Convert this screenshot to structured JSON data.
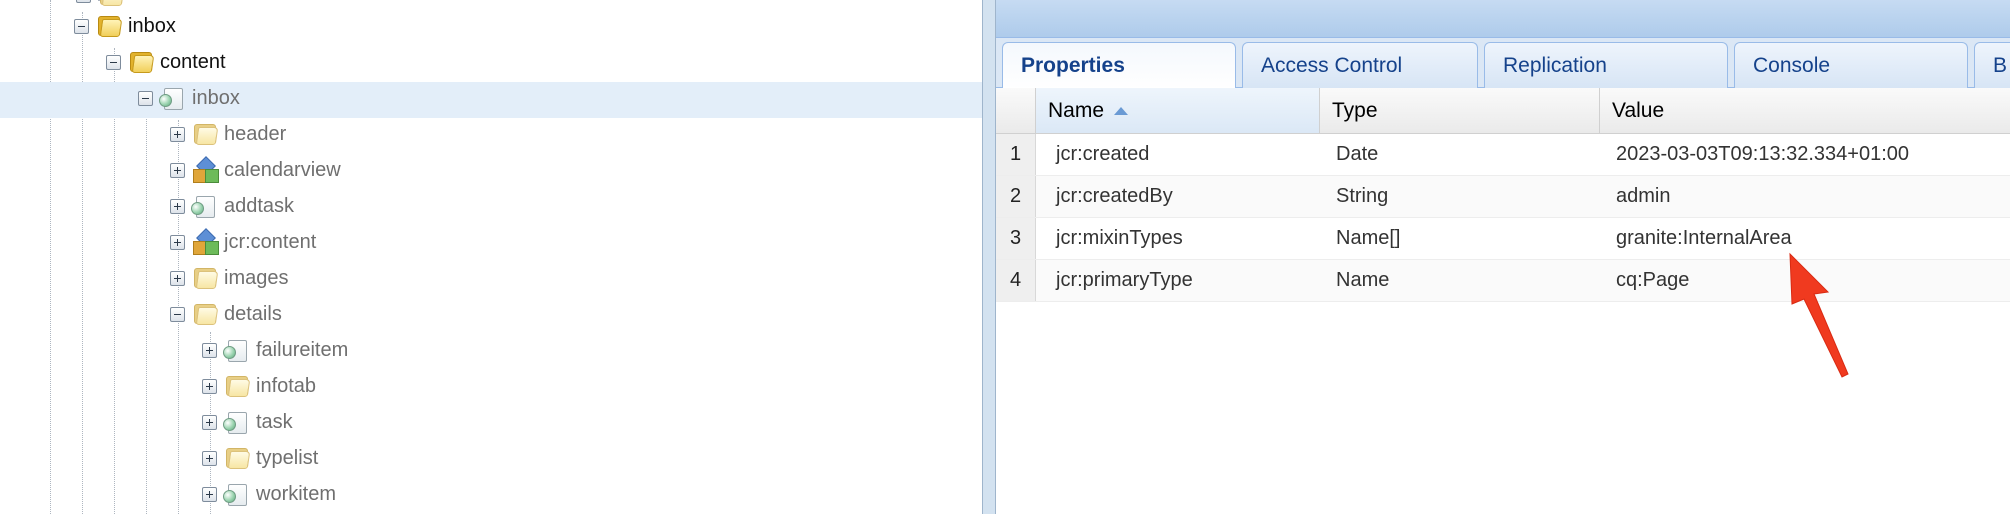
{
  "tree": {
    "nodes": [
      {
        "label": "inbox",
        "icon": "folder-icon"
      },
      {
        "label": "content",
        "icon": "folder-icon"
      },
      {
        "label": "inbox",
        "icon": "page-icon"
      },
      {
        "label": "header",
        "icon": "folder-icon"
      },
      {
        "label": "calendarview",
        "icon": "component-icon"
      },
      {
        "label": "addtask",
        "icon": "page-icon"
      },
      {
        "label": "jcr:content",
        "icon": "component-icon"
      },
      {
        "label": "images",
        "icon": "folder-icon"
      },
      {
        "label": "details",
        "icon": "folder-icon"
      },
      {
        "label": "failureitem",
        "icon": "page-icon"
      },
      {
        "label": "infotab",
        "icon": "folder-icon"
      },
      {
        "label": "task",
        "icon": "page-icon"
      },
      {
        "label": "typelist",
        "icon": "folder-icon"
      },
      {
        "label": "workitem",
        "icon": "page-icon"
      }
    ]
  },
  "tabs": [
    {
      "label": "Properties"
    },
    {
      "label": "Access Control"
    },
    {
      "label": "Replication"
    },
    {
      "label": "Console"
    },
    {
      "label": "B"
    }
  ],
  "grid": {
    "columns": {
      "name": "Name",
      "type": "Type",
      "value": "Value"
    },
    "rows": [
      {
        "num": "1",
        "name": "jcr:created",
        "type": "Date",
        "value": "2023-03-03T09:13:32.334+01:00"
      },
      {
        "num": "2",
        "name": "jcr:createdBy",
        "type": "String",
        "value": "admin"
      },
      {
        "num": "3",
        "name": "jcr:mixinTypes",
        "type": "Name[]",
        "value": "granite:InternalArea"
      },
      {
        "num": "4",
        "name": "jcr:primaryType",
        "type": "Name",
        "value": "cq:Page"
      }
    ]
  },
  "colors": {
    "accent": "#15428b",
    "selection": "#e3eef9",
    "annotation_arrow": "#f03a1f"
  }
}
